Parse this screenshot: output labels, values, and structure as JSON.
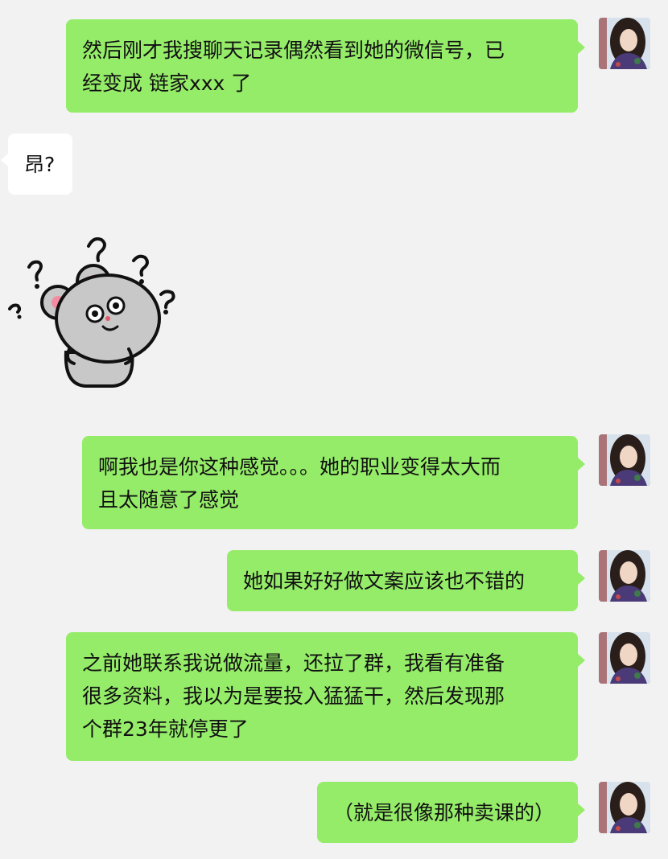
{
  "messages": [
    {
      "side": "right",
      "text": "然后刚才我搜聊天记录偶然看到她的微信号，已\n经变成 链家xxx 了"
    },
    {
      "side": "left",
      "text": "昂?"
    },
    {
      "side": "left",
      "type": "sticker",
      "sticker": "confused-mouse-with-question-marks"
    },
    {
      "side": "right",
      "text": "啊我也是你这种感觉。。。她的职业变得太大而\n且太随意了感觉"
    },
    {
      "side": "right",
      "text": "她如果好好做文案应该也不错的"
    },
    {
      "side": "right",
      "text": "之前她联系我说做流量，还拉了群，我看有准备\n很多资料，我以为是要投入猛猛干，然后发现那\n个群23年就停更了"
    },
    {
      "side": "right",
      "text": "（就是很像那种卖课的）"
    }
  ],
  "colors": {
    "background": "#f2f2f2",
    "outgoing_bubble": "#95ec69",
    "incoming_bubble": "#ffffff",
    "text": "#111111"
  }
}
